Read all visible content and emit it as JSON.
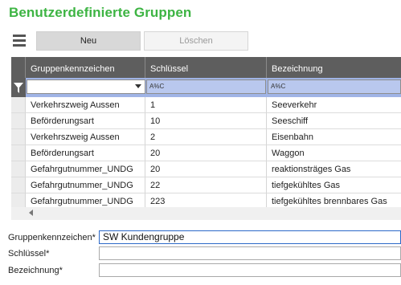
{
  "title": "Benutzerdefinierte Gruppen",
  "toolbar": {
    "new_label": "Neu",
    "delete_label": "Löschen"
  },
  "grid": {
    "columns": [
      "Gruppenkennzeichen",
      "Schlüssel",
      "Bezeichnung"
    ],
    "filter": {
      "col2": "A%C",
      "col3": "A%C"
    },
    "rows": [
      [
        "Verkehrszweig Aussen",
        "1",
        "Seeverkehr"
      ],
      [
        "Beförderungsart",
        "10",
        "Seeschiff"
      ],
      [
        "Verkehrszweig Aussen",
        "2",
        "Eisenbahn"
      ],
      [
        "Beförderungsart",
        "20",
        "Waggon"
      ],
      [
        "Gefahrgutnummer_UNDG",
        "20",
        "reaktionsträges Gas"
      ],
      [
        "Gefahrgutnummer_UNDG",
        "22",
        "tiefgekühltes Gas"
      ],
      [
        "Gefahrgutnummer_UNDG",
        "223",
        "tiefgekühltes brennbares Gas"
      ]
    ]
  },
  "form": {
    "group_label": "Gruppenkennzeichen*",
    "group_value": "SW Kundengruppe",
    "key_label": "Schlüssel*",
    "key_value": "",
    "desc_label": "Bezeichnung*",
    "desc_value": ""
  },
  "colors": {
    "title": "#3db443",
    "header": "#5e5e5e",
    "filter": "#a0b4e6"
  }
}
